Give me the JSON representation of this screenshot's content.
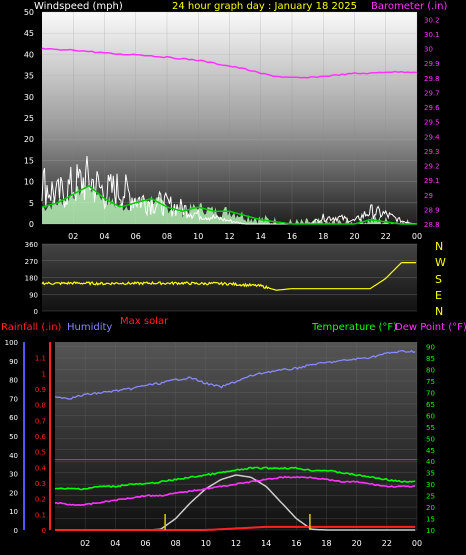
{
  "title": "24 hour graph day : January 18 2025",
  "colors": {
    "background": "#000000",
    "wind_label": "#ffffff",
    "title": "#ffff00",
    "barometer": "#ff33ff",
    "gust": "#ffffff",
    "wind_avg": "#00cc00",
    "wind_fill": "#bfffbf",
    "direction": "#ffff00",
    "compass": "#ffff00",
    "rain": "#ff2222",
    "humidity": "#8888ff",
    "temperature": "#00ff00",
    "dewpoint": "#ff33ff",
    "solar": "#cccccc",
    "solar_marker": "#ddcc00",
    "axis_left_blue": "#5555ff"
  },
  "top_panel": {
    "left_label": "Windspeed (mph)",
    "right_label": "Barometer (.in)"
  },
  "compass_labels": [
    "N",
    "W",
    "S",
    "E",
    "N"
  ],
  "bottom_panel": {
    "rain_label": "Rainfall (.in)",
    "humidity_label": "Humidity",
    "solar_label": "Max solar",
    "temp_label": "Temperature (°F)",
    "dew_label": "Dew Point (°F)"
  },
  "chart_data": [
    {
      "type": "line",
      "name": "wind_barometer",
      "x_ticks": [
        "02",
        "04",
        "06",
        "08",
        "10",
        "12",
        "14",
        "16",
        "18",
        "20",
        "22",
        "00"
      ],
      "x_hours": [
        0,
        2,
        4,
        6,
        8,
        10,
        12,
        14,
        16,
        18,
        20,
        22,
        24
      ],
      "ylim_left": [
        0,
        50
      ],
      "y_ticks_left": [
        "0",
        "5",
        "10",
        "15",
        "20",
        "25",
        "30",
        "35",
        "40",
        "45",
        "50"
      ],
      "ylim_right": [
        28.8,
        30.25
      ],
      "y_ticks_right": [
        "28.8",
        "28.9",
        "29",
        "29.1",
        "29.2",
        "29.3",
        "29.4",
        "29.5",
        "29.6",
        "29.7",
        "29.8",
        "29.9",
        "30",
        "30.1",
        "30.2"
      ],
      "series": [
        {
          "key": "gust",
          "axis": "left",
          "values": [
            13,
            9,
            12,
            14,
            10,
            11,
            8,
            7,
            6,
            5,
            3,
            2,
            1,
            0,
            0,
            0,
            0,
            0,
            2,
            2,
            1,
            4,
            3,
            1,
            0
          ]
        },
        {
          "key": "wind_avg",
          "axis": "left",
          "values": [
            4,
            5,
            7,
            9,
            6,
            4,
            5,
            6,
            4,
            3,
            4,
            3,
            3,
            2,
            1,
            0.5,
            0,
            0,
            0,
            0,
            0,
            1,
            0.5,
            0,
            0
          ]
        },
        {
          "key": "barometer",
          "axis": "right",
          "values": [
            30.0,
            29.99,
            29.99,
            29.98,
            29.97,
            29.96,
            29.96,
            29.95,
            29.94,
            29.93,
            29.92,
            29.9,
            29.88,
            29.86,
            29.83,
            29.81,
            29.8,
            29.8,
            29.81,
            29.82,
            29.83,
            29.83,
            29.84,
            29.84,
            29.84
          ]
        }
      ]
    },
    {
      "type": "line",
      "name": "wind_direction",
      "ylim": [
        0,
        360
      ],
      "y_ticks": [
        "0",
        "90",
        "180",
        "270",
        "360"
      ],
      "series": [
        {
          "key": "direction",
          "values": [
            150,
            148,
            150,
            149,
            147,
            150,
            148,
            150,
            149,
            150,
            147,
            148,
            146,
            140,
            135,
            112,
            120,
            120,
            120,
            120,
            120,
            120,
            175,
            260,
            260
          ]
        }
      ]
    },
    {
      "type": "line",
      "name": "temperature_humidity_rain",
      "ylim_humidity": [
        0,
        100
      ],
      "y_ticks_humidity": [
        "0",
        "10",
        "20",
        "30",
        "40",
        "50",
        "60",
        "70",
        "80",
        "90",
        "100"
      ],
      "ylim_rain": [
        0,
        1.2
      ],
      "y_ticks_rain": [
        "0",
        "0.1",
        "0.2",
        "0.3",
        "0.4",
        "0.5",
        "0.6",
        "0.7",
        "0.8",
        "0.9",
        "1",
        "1.1"
      ],
      "ylim_temp": [
        10,
        92
      ],
      "y_ticks_temp": [
        "10",
        "15",
        "20",
        "25",
        "30",
        "35",
        "40",
        "45",
        "50",
        "55",
        "60",
        "65",
        "70",
        "75",
        "80",
        "85",
        "90"
      ],
      "red_line_value": 0.45,
      "solar_markers_hours": [
        7.3,
        16.9
      ],
      "series": [
        {
          "key": "humidity",
          "axis": "humidity",
          "values": [
            71,
            70,
            72,
            73,
            74,
            75,
            77,
            78,
            80,
            81,
            78,
            76,
            79,
            82,
            84,
            85,
            86,
            88,
            89,
            90,
            91,
            92,
            94,
            95,
            95
          ]
        },
        {
          "key": "temperature",
          "axis": "temp",
          "values": [
            28,
            28,
            28,
            29,
            29,
            30,
            30,
            31,
            32,
            33,
            34,
            35,
            36,
            37,
            37,
            37,
            37,
            36,
            36,
            35,
            34,
            33,
            32,
            31,
            31
          ]
        },
        {
          "key": "dewpoint",
          "axis": "temp",
          "values": [
            22,
            21,
            21,
            22,
            23,
            24,
            25,
            25,
            26,
            27,
            28,
            29,
            30,
            31,
            32,
            33,
            33,
            33,
            32,
            31,
            31,
            30,
            29,
            29,
            29
          ]
        },
        {
          "key": "rain",
          "axis": "rain",
          "values": [
            0,
            0,
            0,
            0,
            0,
            0,
            0,
            0,
            0,
            0,
            0,
            0.005,
            0.01,
            0.015,
            0.02,
            0.02,
            0.02,
            0.02,
            0.02,
            0.02,
            0.02,
            0.02,
            0.02,
            0.02,
            0.02
          ]
        },
        {
          "key": "solar",
          "axis": "temp",
          "values": [
            10,
            10,
            10,
            10,
            10,
            10,
            10,
            10.3,
            15,
            22,
            28,
            32,
            34,
            33,
            29,
            22,
            15,
            10.3,
            10,
            10,
            10,
            10,
            10,
            10,
            10
          ]
        }
      ]
    }
  ]
}
